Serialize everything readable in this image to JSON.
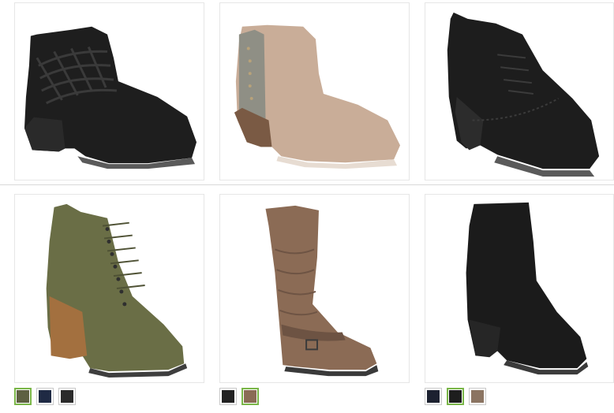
{
  "products": [
    {
      "name": "black-strappy-ankle-bootie",
      "colors": [
        "#1f1f1f",
        "#3a3a3a"
      ]
    },
    {
      "name": "taupe-studded-ankle-bootie",
      "colors": [
        "#c7a995",
        "#8a8a80"
      ]
    },
    {
      "name": "black-lace-up-wedge-bootie",
      "colors": [
        "#1e1e1e"
      ]
    },
    {
      "name": "olive-lace-up-heel-bootie",
      "colors": [
        "#6d7148",
        "#a06d45"
      ]
    },
    {
      "name": "brown-slouch-tall-boot",
      "colors": [
        "#8a6b55"
      ]
    },
    {
      "name": "black-stretch-sock-bootie",
      "colors": [
        "#1b1b1b"
      ]
    }
  ],
  "swatches": {
    "olive_bootie": [
      {
        "color": "#5e6042",
        "selected": true
      },
      {
        "color": "#1f2a44",
        "selected": false
      },
      {
        "color": "#2b2b2b",
        "selected": false
      }
    ],
    "slouch_boot": [
      {
        "color": "#222222",
        "selected": false
      },
      {
        "color": "#8a6b55",
        "selected": true
      }
    ],
    "sock_bootie": [
      {
        "color": "#1c2130",
        "selected": false
      },
      {
        "color": "#1e1e1e",
        "selected": true
      },
      {
        "color": "#8b7462",
        "selected": false
      }
    ]
  }
}
